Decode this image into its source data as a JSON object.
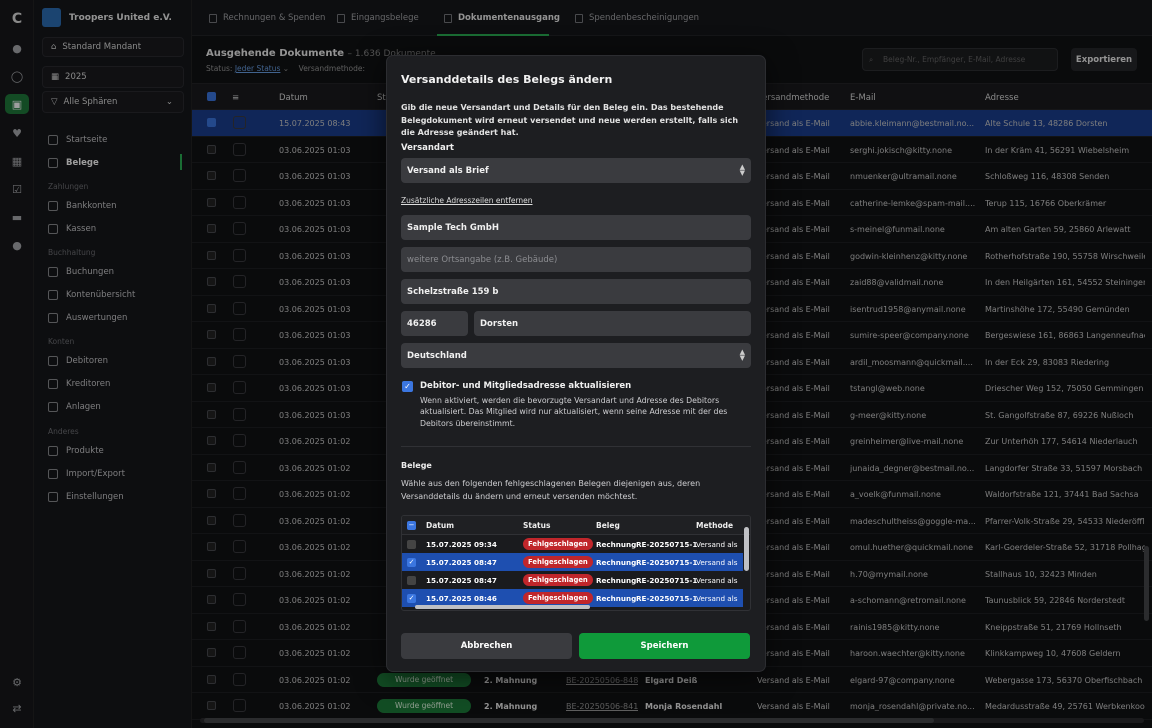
{
  "org": {
    "name": "Troopers United e.V."
  },
  "sidebar": {
    "mandant": "Standard Mandant",
    "year": "2025",
    "sphere": "Alle Sphären",
    "items": [
      {
        "label": "Startseite"
      },
      {
        "label": "Belege"
      }
    ],
    "sec_payments": "Zahlungen",
    "payments": [
      {
        "label": "Bankkonten"
      },
      {
        "label": "Kassen"
      }
    ],
    "sec_accounting": "Buchhaltung",
    "accounting": [
      {
        "label": "Buchungen"
      },
      {
        "label": "Kontenübersicht"
      },
      {
        "label": "Auswertungen"
      }
    ],
    "sec_accounts": "Konten",
    "accounts": [
      {
        "label": "Debitoren"
      },
      {
        "label": "Kreditoren"
      },
      {
        "label": "Anlagen"
      }
    ],
    "sec_other": "Anderes",
    "other": [
      {
        "label": "Produkte"
      },
      {
        "label": "Import/Export"
      },
      {
        "label": "Einstellungen"
      }
    ]
  },
  "tabs": [
    {
      "label": "Rechnungen & Spenden"
    },
    {
      "label": "Eingangsbelege"
    },
    {
      "label": "Dokumentenausgang"
    },
    {
      "label": "Spendenbescheinigungen"
    }
  ],
  "page": {
    "title": "Ausgehende Dokumente",
    "count": "– 1.636 Dokumente",
    "status_label": "Status:",
    "status_value": "Jeder Status",
    "method_label": "Versandmethode:",
    "search_placeholder": "Beleg-Nr., Empfänger, E-Mail, Adresse",
    "export": "Exportieren"
  },
  "table": {
    "headers": {
      "datum": "Datum",
      "st": "St",
      "versand": "Versandmethode",
      "email": "E-Mail",
      "adresse": "Adresse"
    },
    "rows": [
      {
        "datum": "15.07.2025 08:43",
        "versand": "Versand als E-Mail",
        "email": "abbie.kleimann@bestmail.no...",
        "adresse": "Alte Schule 13, 48286 Dorsten"
      },
      {
        "datum": "03.06.2025 01:03",
        "versand": "Versand als E-Mail",
        "email": "serghi.jokisch@kitty.none",
        "adresse": "In der Kräm 41, 56291 Wiebelsheim"
      },
      {
        "datum": "03.06.2025 01:03",
        "versand": "Versand als E-Mail",
        "email": "nmuenker@ultramail.none",
        "adresse": "Schloßweg 116, 48308 Senden"
      },
      {
        "datum": "03.06.2025 01:03",
        "versand": "Versand als E-Mail",
        "email": "catherine-lemke@spam-mail....",
        "adresse": "Terup 115, 16766 Oberkrämer"
      },
      {
        "datum": "03.06.2025 01:03",
        "versand": "Versand als E-Mail",
        "email": "s-meinel@funmail.none",
        "adresse": "Am alten Garten 59, 25860 Arlewatt"
      },
      {
        "datum": "03.06.2025 01:03",
        "versand": "Versand als E-Mail",
        "email": "godwin-kleinhenz@kitty.none",
        "adresse": "Rotherhofstraße 190, 55758 Wirschweile"
      },
      {
        "datum": "03.06.2025 01:03",
        "versand": "Versand als E-Mail",
        "email": "zaid88@validmail.none",
        "adresse": "In den Heilgärten 161, 54552 Steiningen"
      },
      {
        "datum": "03.06.2025 01:03",
        "versand": "Versand als E-Mail",
        "email": "isentrud1958@anymail.none",
        "adresse": "Martinshöhe 172, 55490 Gemünden"
      },
      {
        "datum": "03.06.2025 01:03",
        "versand": "Versand als E-Mail",
        "email": "sumire-speer@company.none",
        "adresse": "Bergeswiese 161, 86863 Langenneufnach"
      },
      {
        "datum": "03.06.2025 01:03",
        "versand": "Versand als E-Mail",
        "email": "ardil_moosmann@quickmail....",
        "adresse": "In der Eck 29, 83083 Riedering"
      },
      {
        "datum": "03.06.2025 01:03",
        "versand": "Versand als E-Mail",
        "email": "tstangl@web.none",
        "adresse": "Driescher Weg 152, 75050 Gemmingen"
      },
      {
        "datum": "03.06.2025 01:03",
        "versand": "Versand als E-Mail",
        "email": "g-meer@kitty.none",
        "adresse": "St. Gangolfstraße 87, 69226 Nußloch"
      },
      {
        "datum": "03.06.2025 01:02",
        "versand": "Versand als E-Mail",
        "email": "greinheimer@live-mail.none",
        "adresse": "Zur Unterhöh 177, 54614 Niederlauch"
      },
      {
        "datum": "03.06.2025 01:02",
        "versand": "Versand als E-Mail",
        "email": "junaida_degner@bestmail.no...",
        "adresse": "Langdorfer Straße 33, 51597 Morsbach"
      },
      {
        "datum": "03.06.2025 01:02",
        "versand": "Versand als E-Mail",
        "email": "a_voelk@funmail.none",
        "adresse": "Waldorfstraße 121, 37441 Bad Sachsa"
      },
      {
        "datum": "03.06.2025 01:02",
        "versand": "Versand als E-Mail",
        "email": "madeschultheiss@goggle-ma...",
        "adresse": "Pfarrer-Volk-Straße 29, 54533 Niederöffli"
      },
      {
        "datum": "03.06.2025 01:02",
        "versand": "Versand als E-Mail",
        "email": "omul.huether@quickmail.none",
        "adresse": "Karl-Goerdeler-Straße 52, 31718 Pollhage"
      },
      {
        "datum": "03.06.2025 01:02",
        "versand": "Versand als E-Mail",
        "email": "h.70@mymail.none",
        "adresse": "Stallhaus 10, 32423 Minden"
      },
      {
        "datum": "03.06.2025 01:02",
        "versand": "Versand als E-Mail",
        "email": "a-schomann@retromail.none",
        "adresse": "Taunusblick 59, 22846 Norderstedt"
      },
      {
        "datum": "03.06.2025 01:02",
        "versand": "Versand als E-Mail",
        "email": "rainis1985@kitty.none",
        "adresse": "Kneippstraße 51, 21769 Hollnseth"
      },
      {
        "datum": "03.06.2025 01:02",
        "versand": "Versand als E-Mail",
        "email": "haroon.waechter@kitty.none",
        "adresse": "Klinkkampweg 10, 47608 Geldern"
      },
      {
        "datum": "03.06.2025 01:02",
        "status": "Wurde geöffnet",
        "typ": "2. Mahnung",
        "nr": "BE-20250506-848",
        "name": "Elgard Deiß",
        "versand": "Versand als E-Mail",
        "email": "elgard-97@company.none",
        "adresse": "Webergasse 173, 56370 Oberfischbach"
      },
      {
        "datum": "03.06.2025 01:02",
        "status": "Wurde geöffnet",
        "typ": "2. Mahnung",
        "nr": "BE-20250506-841",
        "name": "Monja Rosendahl",
        "versand": "Versand als E-Mail",
        "email": "monja_rosendahl@private.no...",
        "adresse": "Medardusstraße 49, 25761 Werbkenkoog"
      }
    ]
  },
  "modal": {
    "title": "Versanddetails des Belegs ändern",
    "description": "Gib die neue Versandart und Details für den Beleg ein. Das bestehende Belegdokument wird erneut versendet und neue werden erstellt, falls sich die Adresse geändert hat.",
    "versandart_label": "Versandart",
    "versandart_value": "Versand als Brief",
    "remove_lines_link": "Zusätzliche Adresszeilen entfernen",
    "name": "Sample Tech GmbH",
    "extra_placeholder": "weitere Ortsangabe (z.B. Gebäude)",
    "street": "Schelzstraße 159 b",
    "zip": "46286",
    "city": "Dorsten",
    "country": "Deutschland",
    "checkbox_label": "Debitor- und Mitgliedsadresse aktualisieren",
    "checkbox_desc": "Wenn aktiviert, werden die bevorzugte Versandart und Adresse des Debitors aktualisiert. Das Mitglied wird nur aktualisiert, wenn seine Adresse mit der des Debitors übereinstimmt.",
    "belege_title": "Belege",
    "belege_desc": "Wähle aus den folgenden fehlgeschlagenen Belegen diejenigen aus, deren Versanddetails du ändern und erneut versenden möchtest.",
    "inner_headers": {
      "datum": "Datum",
      "status": "Status",
      "beleg": "Beleg",
      "methode": "Methode"
    },
    "inner_rows": [
      {
        "datum": "15.07.2025 09:34",
        "status": "Fehlgeschlagen",
        "typ": "Rechnung",
        "nr": "RE-20250715-1",
        "methode": "Versand als",
        "checked": false
      },
      {
        "datum": "15.07.2025 08:47",
        "status": "Fehlgeschlagen",
        "typ": "Rechnung",
        "nr": "RE-20250715-1",
        "methode": "Versand als",
        "checked": true
      },
      {
        "datum": "15.07.2025 08:47",
        "status": "Fehlgeschlagen",
        "typ": "Rechnung",
        "nr": "RE-20250715-1",
        "methode": "Versand als",
        "checked": false
      },
      {
        "datum": "15.07.2025 08:46",
        "status": "Fehlgeschlagen",
        "typ": "Rechnung",
        "nr": "RE-20250715-1",
        "methode": "Versand als",
        "checked": true
      }
    ],
    "cancel": "Abbrechen",
    "save": "Speichern"
  }
}
